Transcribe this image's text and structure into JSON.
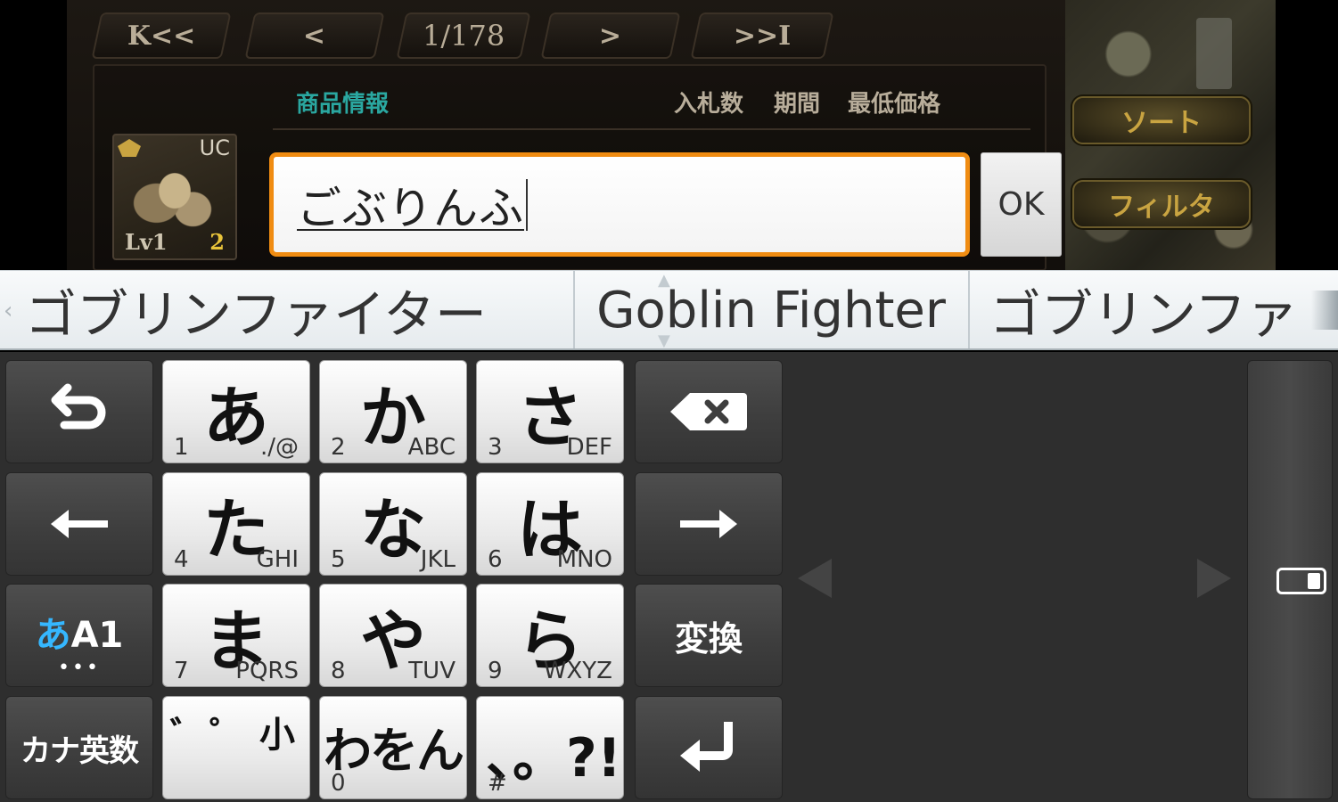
{
  "game": {
    "pager": {
      "first": "K<<",
      "prev": "<",
      "page": "1/178",
      "next": ">",
      "last": ">>I"
    },
    "columns": {
      "item": "商品情報",
      "bids": "入札数",
      "period": "期間",
      "min_price": "最低価格"
    },
    "item": {
      "rarity": "UC",
      "level": "Lv1",
      "quantity": "2"
    },
    "buttons": {
      "sort": "ソート",
      "filter": "フィルタ"
    }
  },
  "dialog": {
    "input_value": "ごぶりんふ",
    "ok_label": "OK",
    "accent_color": "#f08c12"
  },
  "candidates": [
    "ゴブリンファイター",
    "Goblin Fighter",
    "ゴブリンファ"
  ],
  "keyboard": {
    "undo_icon": "undo-icon",
    "backspace_icon": "backspace-icon",
    "left_icon": "arrow-left-icon",
    "right_icon": "arrow-right-icon",
    "enter_icon": "enter-icon",
    "keys": [
      {
        "kana": "あ",
        "num": "1",
        "alpha": "./@"
      },
      {
        "kana": "か",
        "num": "2",
        "alpha": "ABC"
      },
      {
        "kana": "さ",
        "num": "3",
        "alpha": "DEF"
      },
      {
        "kana": "た",
        "num": "4",
        "alpha": "GHI"
      },
      {
        "kana": "な",
        "num": "5",
        "alpha": "JKL"
      },
      {
        "kana": "は",
        "num": "6",
        "alpha": "MNO"
      },
      {
        "kana": "ま",
        "num": "7",
        "alpha": "PQRS"
      },
      {
        "kana": "や",
        "num": "8",
        "alpha": "TUV"
      },
      {
        "kana": "ら",
        "num": "9",
        "alpha": "WXYZ"
      }
    ],
    "mode": {
      "kana": "あ",
      "latin": "A1",
      "dots": "•••"
    },
    "convert": "変換",
    "kanaeisu": "カナ英数",
    "dakuten": {
      "a": "゛",
      "b": "゜",
      "c": "小"
    },
    "wawon": {
      "kana": "わをん",
      "num": "0"
    },
    "punct": {
      "label": "、。?!",
      "num": "#"
    },
    "mode_accent": "#35b7ff"
  }
}
